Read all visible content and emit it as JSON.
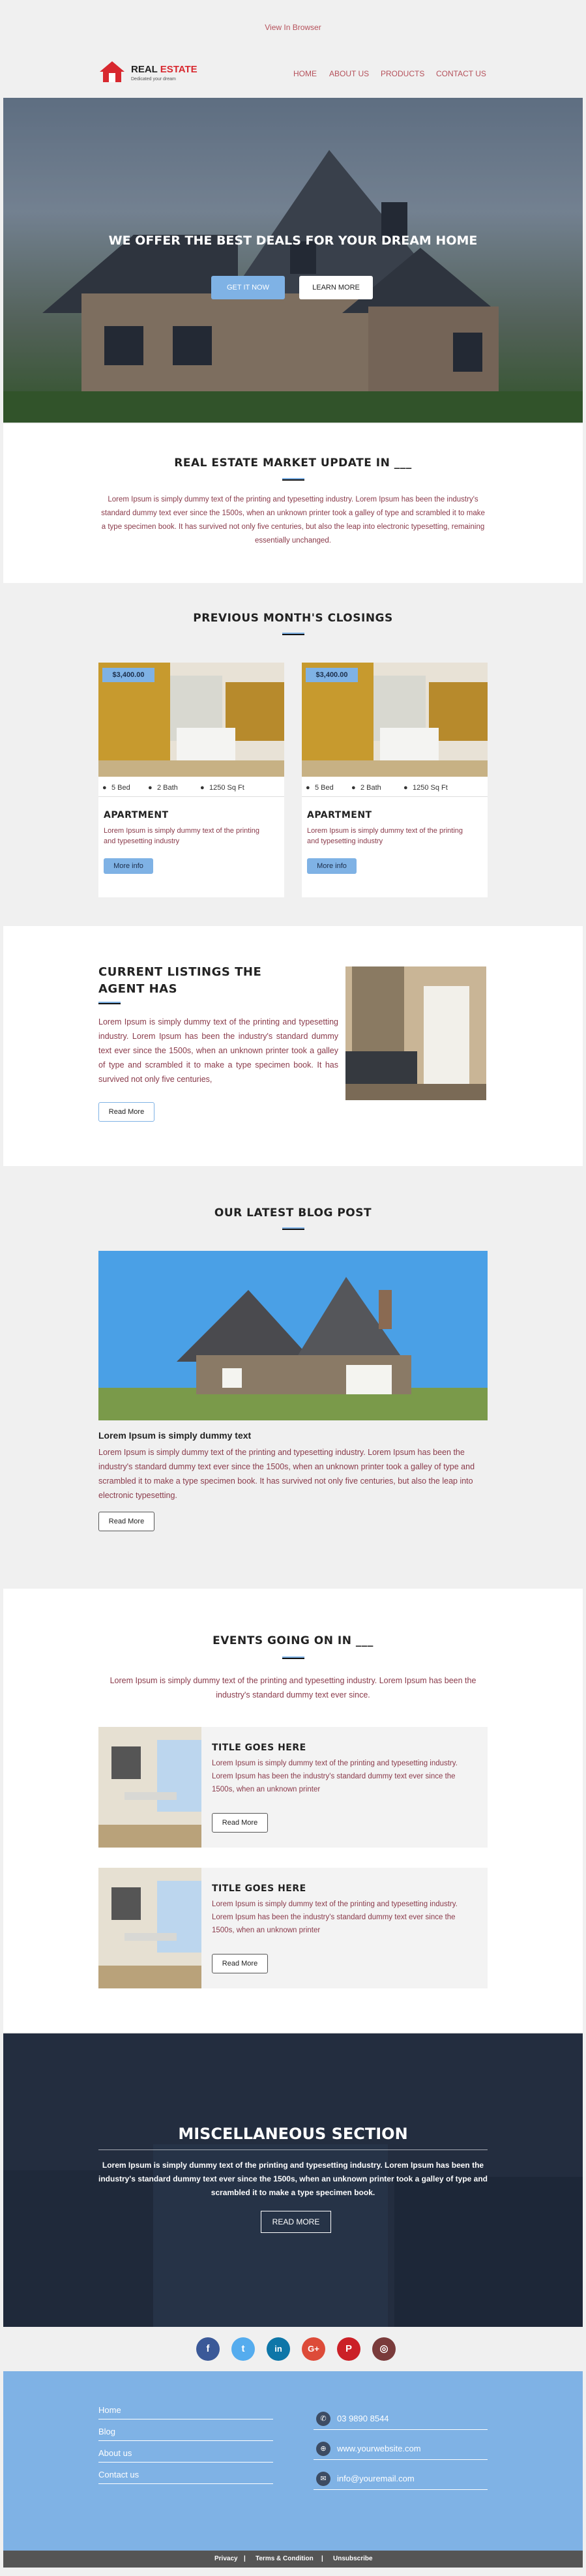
{
  "topbar": {
    "view_in_browser": "View In Browser"
  },
  "header": {
    "logo_word1": "REAL",
    "logo_word2": "ESTATE",
    "logo_tagline": "Dedicated your dream",
    "nav": [
      "HOME",
      "ABOUT US",
      "PRODUCTS",
      "CONTACT US"
    ]
  },
  "hero": {
    "headline": "WE OFFER THE BEST DEALS FOR YOUR DREAM HOME",
    "primary_button": "GET IT NOW",
    "secondary_button": "LEARN MORE"
  },
  "market_update": {
    "title": "REAL ESTATE MARKET UPDATE IN ___",
    "body": "Lorem Ipsum is simply dummy text of the printing and typesetting industry. Lorem Ipsum has been the industry's standard dummy text ever since the 1500s, when an unknown printer took a galley of type and scrambled it to make a type specimen book. It has survived not only five centuries, but also the leap into electronic typesetting, remaining essentially unchanged."
  },
  "closings": {
    "title": "PREVIOUS MONTH'S CLOSINGS",
    "cards": [
      {
        "price": "$3,400.00",
        "beds": "5 Bed",
        "baths": "2 Bath",
        "area": "1250 Sq Ft",
        "type": "APARTMENT",
        "desc": "Lorem Ipsum is simply dummy text of the printing and typesetting industry",
        "button": "More info"
      },
      {
        "price": "$3,400.00",
        "beds": "5 Bed",
        "baths": "2 Bath",
        "area": "1250 Sq Ft",
        "type": "APARTMENT",
        "desc": "Lorem Ipsum is simply dummy text of the printing and typesetting industry",
        "button": "More info"
      }
    ]
  },
  "listings": {
    "title_line1": "CURRENT LISTINGS THE",
    "title_line2": "AGENT HAS",
    "body": "Lorem Ipsum is simply dummy text of the printing and typesetting industry. Lorem Ipsum has been the industry's standard dummy text ever since the 1500s, when an unknown printer took a galley of type and scrambled it to make a type specimen book. It has survived not only five centuries,",
    "button": "Read More"
  },
  "blog": {
    "title": "OUR LATEST BLOG POST",
    "post_title": "Lorem Ipsum is simply dummy text",
    "body": "Lorem Ipsum is simply dummy text of the printing and typesetting industry. Lorem Ipsum has been the industry's standard dummy text ever since the 1500s, when an unknown printer took a galley of type and scrambled it to make a type specimen book. It has survived not only five centuries, but also the leap into electronic typesetting.",
    "button": "Read More"
  },
  "events": {
    "title": "EVENTS GOING ON IN ___",
    "intro": "Lorem Ipsum is simply dummy text of the printing and typesetting industry. Lorem Ipsum has been the industry's standard dummy text ever since.",
    "items": [
      {
        "title": "TITLE GOES HERE",
        "body": "Lorem Ipsum is simply dummy text of the printing and typesetting industry. Lorem Ipsum has been the industry's standard dummy text ever since the 1500s, when an unknown printer",
        "button": "Read More"
      },
      {
        "title": "TITLE GOES HERE",
        "body": "Lorem Ipsum is simply dummy text of the printing and typesetting industry. Lorem Ipsum has been the industry's standard dummy text ever since the 1500s, when an unknown printer",
        "button": "Read More"
      }
    ]
  },
  "misc": {
    "title": "MISCELLANEOUS SECTION",
    "body": "Lorem Ipsum is simply dummy text of the printing and typesetting industry. Lorem Ipsum has been the industry's standard dummy text ever since the 1500s, when an unknown printer took a galley of type and scrambled it to make a type specimen book.",
    "button": "READ MORE"
  },
  "social": [
    {
      "icon": "facebook-icon",
      "glyph": "f",
      "color": "#3b5998"
    },
    {
      "icon": "twitter-icon",
      "glyph": "t",
      "color": "#55acee"
    },
    {
      "icon": "linkedin-icon",
      "glyph": "in",
      "color": "#0e76a8"
    },
    {
      "icon": "google-plus-icon",
      "glyph": "G+",
      "color": "#dd4b39"
    },
    {
      "icon": "pinterest-icon",
      "glyph": "P",
      "color": "#cb2027"
    },
    {
      "icon": "instagram-icon",
      "glyph": "◎",
      "color": "#7a3b3b"
    }
  ],
  "footer": {
    "links": [
      "Home",
      "Blog",
      "About us",
      "Contact us"
    ],
    "phone": "03 9890 8544",
    "website": "www.yourwebsite.com",
    "email": "info@youremail.com",
    "bottom_links": [
      "Privacy",
      "Terms & Condition",
      "Unsubscribe"
    ],
    "separator": "|"
  },
  "colors": {
    "accent": "#7fb2e5",
    "brand_red": "#d8282f",
    "nav_text": "#b5505a",
    "lorem_text": "#8a3a4a",
    "footer_bg": "#7fb2e5",
    "bottom_bar": "#555555"
  }
}
